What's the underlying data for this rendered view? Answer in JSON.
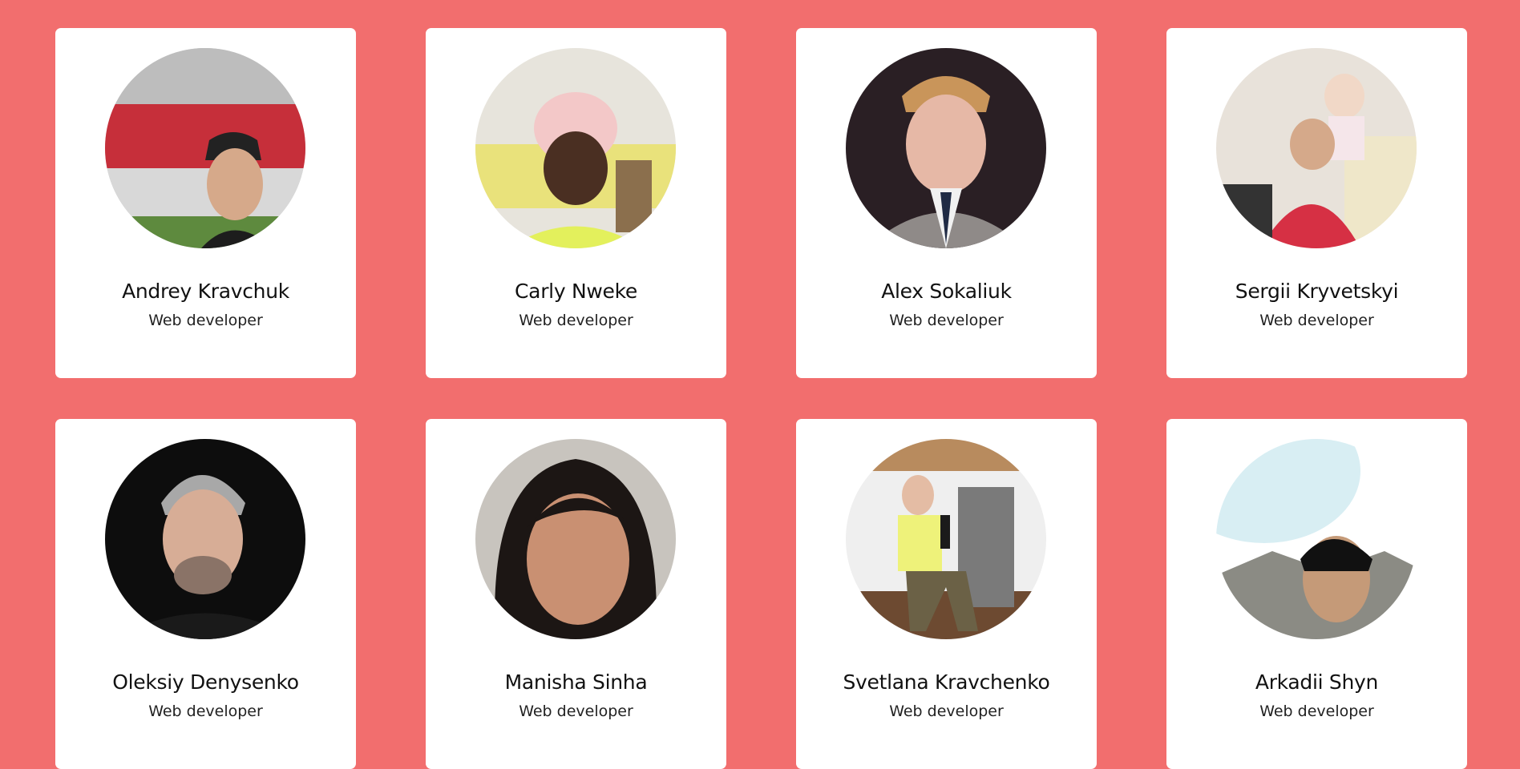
{
  "team": {
    "members": [
      {
        "name": "Andrey Kravchuk",
        "role": "Web developer"
      },
      {
        "name": "Carly Nweke",
        "role": "Web developer"
      },
      {
        "name": "Alex Sokaliuk",
        "role": "Web developer"
      },
      {
        "name": "Sergii Kryvetskyi",
        "role": "Web developer"
      },
      {
        "name": "Oleksiy Denysenko",
        "role": "Web developer"
      },
      {
        "name": "Manisha Sinha",
        "role": "Web developer"
      },
      {
        "name": "Svetlana Kravchenko",
        "role": "Web developer"
      },
      {
        "name": "Arkadii Shyn",
        "role": "Web developer"
      }
    ]
  },
  "colors": {
    "page_background": "#f26e6e",
    "card_background": "#ffffff",
    "text": "#111111"
  }
}
